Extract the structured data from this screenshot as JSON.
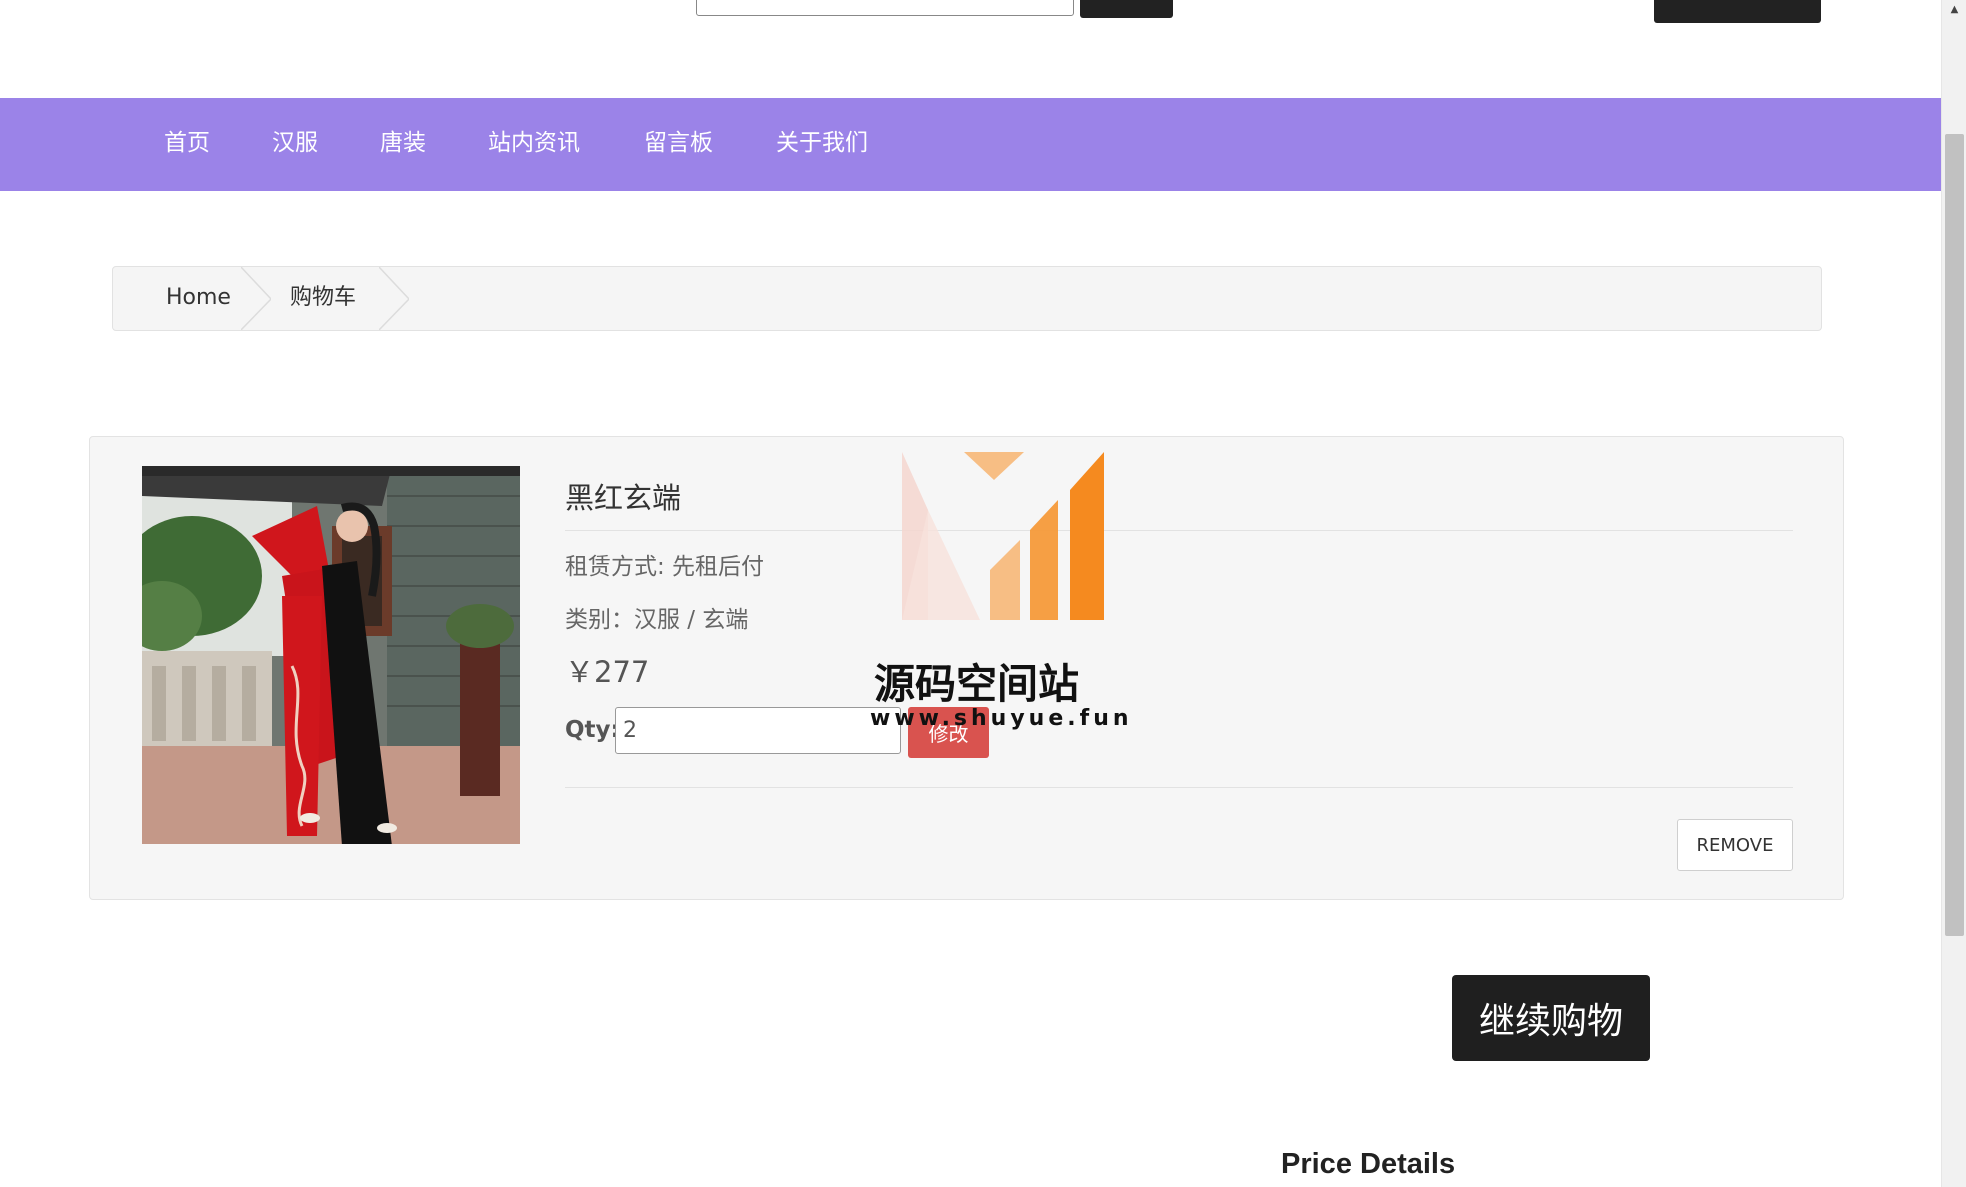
{
  "header": {
    "search_placeholder": "",
    "search_button_label": "",
    "account_button_label": ""
  },
  "nav": {
    "items": [
      {
        "label": "首页"
      },
      {
        "label": "汉服"
      },
      {
        "label": "唐装"
      },
      {
        "label": "站内资讯"
      },
      {
        "label": "留言板"
      },
      {
        "label": "关于我们"
      }
    ]
  },
  "breadcrumb": {
    "items": [
      {
        "label": "Home"
      },
      {
        "label": "购物车"
      }
    ]
  },
  "cart": {
    "items": [
      {
        "name": "黑红玄端",
        "rental_mode": "租赁方式: 先租后付",
        "category": "类别：汉服 / 玄端",
        "price": "￥277",
        "qty_label": "Qty:",
        "qty_value": "2",
        "update_label": "修改",
        "remove_label": "REMOVE"
      }
    ]
  },
  "watermark": {
    "title": "源码空间站",
    "url": "www.shuyue.fun"
  },
  "actions": {
    "continue_label": "继续购物"
  },
  "summary": {
    "heading": "Price Details"
  },
  "colors": {
    "nav_bg": "#9b83e8",
    "update_button": "#d9534f",
    "dark_button": "#1f1f1f",
    "watermark_orange": "#f58a1f"
  }
}
